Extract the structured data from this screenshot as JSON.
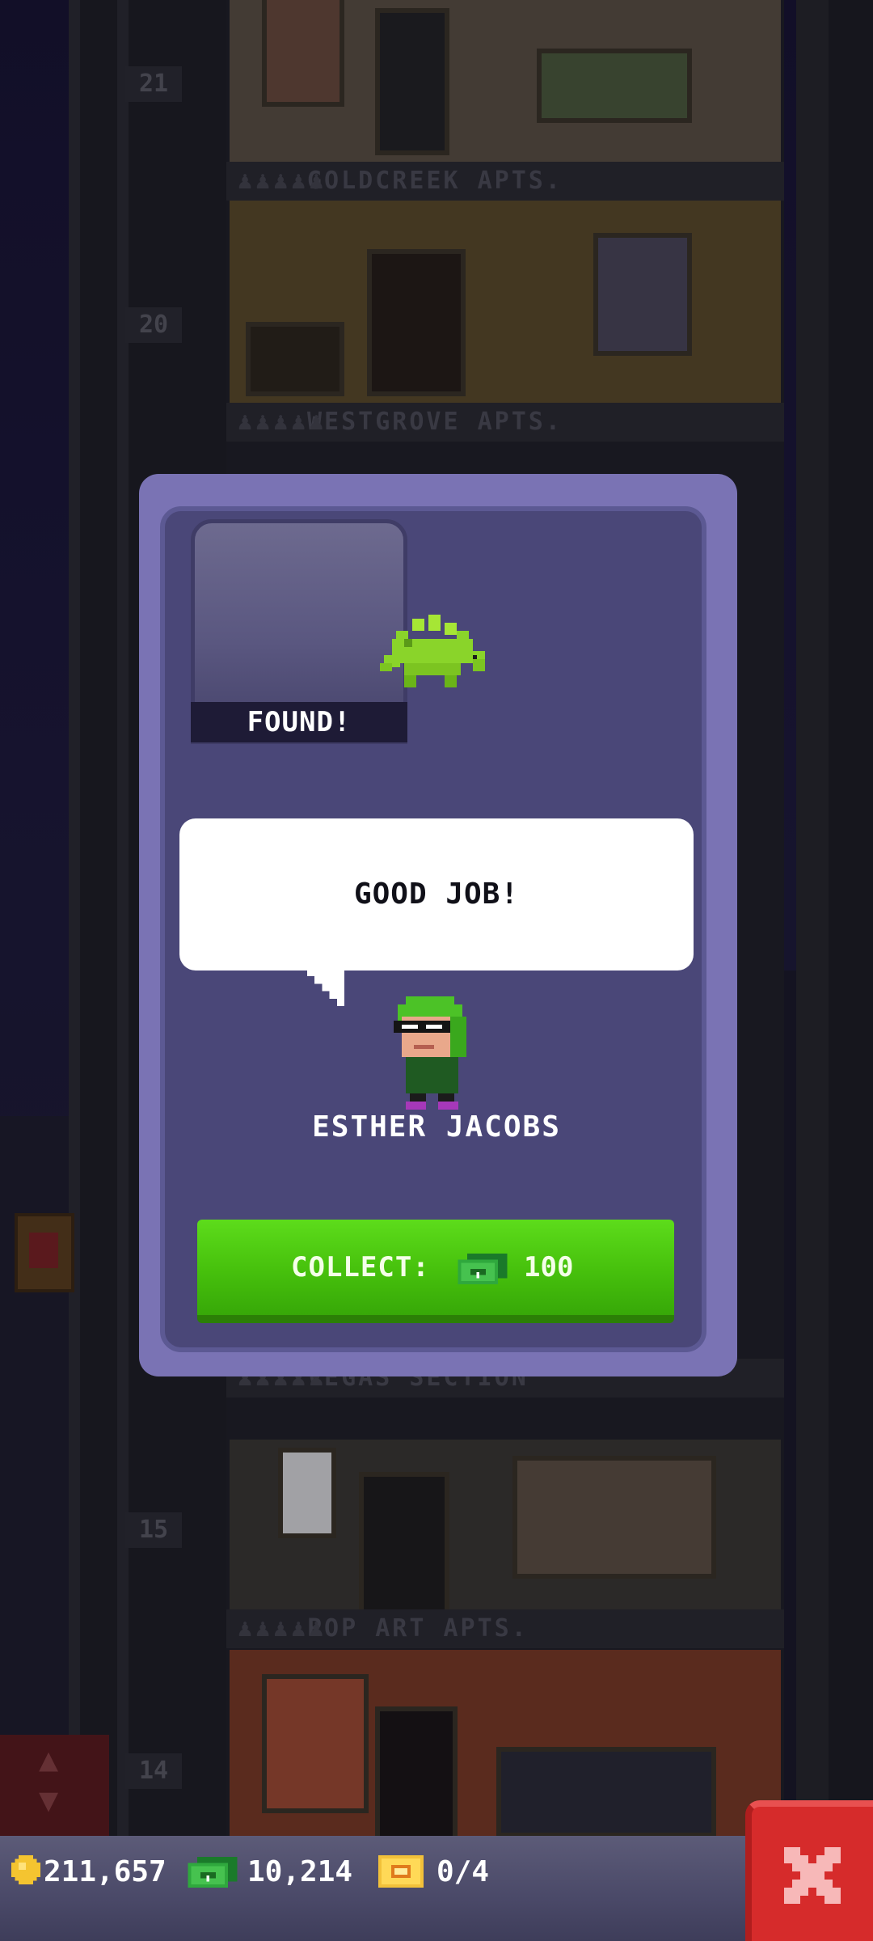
{
  "background": {
    "floors": [
      {
        "number": "21",
        "name": "GOLDCREEK APTS."
      },
      {
        "number": "20",
        "name": "WESTGROVE APTS."
      },
      {
        "number": "",
        "name": "VEGAS SECTION"
      },
      {
        "number": "15",
        "name": "POP ART APTS."
      },
      {
        "number": "14",
        "name": ""
      }
    ]
  },
  "modal": {
    "found_label": "FOUND!",
    "item_icon": "green-stegosaurus-icon",
    "speech": "GOOD JOB!",
    "npc_name": "ESTHER JACOBS",
    "collect_label": "COLLECT:",
    "collect_icon": "cash-icon",
    "collect_amount": "100"
  },
  "bottom_bar": {
    "coins": "211,657",
    "bux": "10,214",
    "tickets": "0/4"
  },
  "colors": {
    "modal_border": "#7a73b4",
    "modal_fill": "#4a4778",
    "collect_green": "#46c00c",
    "close_red": "#d62b2b"
  }
}
